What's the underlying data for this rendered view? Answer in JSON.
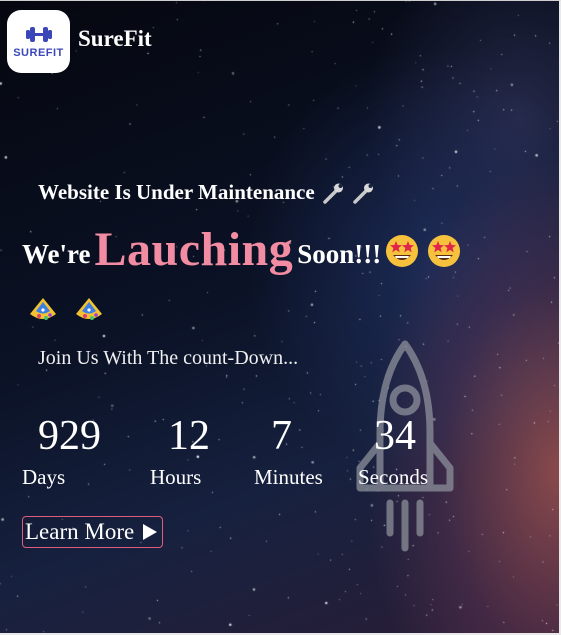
{
  "brand": {
    "logo_text": "SUREFIT",
    "name": "SureFit"
  },
  "hero": {
    "maintenance_text": "Website Is Under Maintenance",
    "headline_prefix": "We're",
    "headline_highlight": "Lauching",
    "headline_suffix": "Soon!!!",
    "join_text": "Join Us With The count-Down..."
  },
  "countdown": [
    {
      "value": "929",
      "label": "Days"
    },
    {
      "value": "12",
      "label": "Hours"
    },
    {
      "value": "7",
      "label": "Minutes"
    },
    {
      "value": "34",
      "label": "Seconds"
    }
  ],
  "cta": {
    "label": "Learn More"
  },
  "icons": {
    "logo": "dumbbell-icon",
    "maintenance": [
      "wrench-icon",
      "wrench-icon"
    ],
    "headline": [
      "star-struck-emoji-icon",
      "star-struck-emoji-icon"
    ],
    "party": [
      "party-popper-icon",
      "party-popper-icon"
    ],
    "cta": "play-arrow-icon",
    "background": "rocket-icon"
  },
  "colors": {
    "highlight": "#f18ca2",
    "button_border": "#e05c7a",
    "logo_blue": "#3b47b8"
  }
}
